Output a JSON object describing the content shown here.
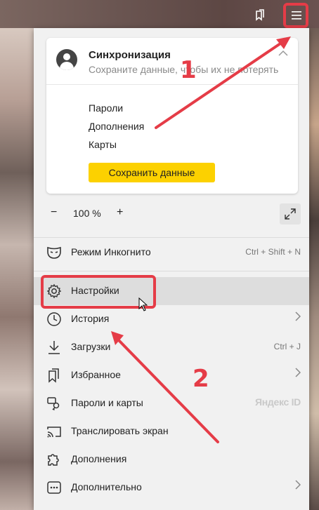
{
  "sync": {
    "title": "Синхронизация",
    "subtitle": "Сохраните данные, чтобы их не потерять",
    "items": [
      "Пароли",
      "Дополнения",
      "Карты"
    ],
    "save_button": "Сохранить данные"
  },
  "zoom": {
    "minus": "−",
    "value": "100 %",
    "plus": "+"
  },
  "menu": {
    "incognito": {
      "label": "Режим Инкогнито",
      "shortcut": "Ctrl + Shift + N"
    },
    "settings": {
      "label": "Настройки"
    },
    "history": {
      "label": "История"
    },
    "downloads": {
      "label": "Загрузки",
      "shortcut": "Ctrl + J"
    },
    "favorites": {
      "label": "Избранное"
    },
    "passwords": {
      "label": "Пароли и карты",
      "badge": "Яндекс ID"
    },
    "cast": {
      "label": "Транслировать экран"
    },
    "extensions": {
      "label": "Дополнения"
    },
    "more": {
      "label": "Дополнительно"
    }
  },
  "annotations": {
    "step1": "1",
    "step2": "2"
  },
  "colors": {
    "accent_yellow": "#fcd100",
    "annotation_red": "#e53c47"
  }
}
